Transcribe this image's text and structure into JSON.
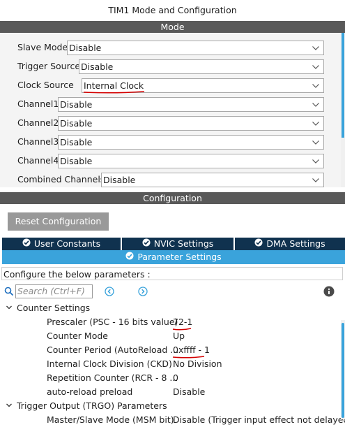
{
  "window": {
    "title": "TIM1 Mode and Configuration"
  },
  "mode": {
    "header": "Mode",
    "rows": [
      {
        "label": "Slave Mode",
        "value": "Disable"
      },
      {
        "label": "Trigger Source",
        "value": "Disable"
      },
      {
        "label": "Clock Source",
        "value": "Internal Clock"
      },
      {
        "label": "Channel1",
        "value": "Disable"
      },
      {
        "label": "Channel2",
        "value": "Disable"
      },
      {
        "label": "Channel3",
        "value": "Disable"
      },
      {
        "label": "Channel4",
        "value": "Disable"
      },
      {
        "label": "Combined Channels",
        "value": "Disable"
      }
    ]
  },
  "configuration": {
    "header": "Configuration",
    "reset_label": "Reset Configuration",
    "tabs": [
      "User Constants",
      "NVIC Settings",
      "DMA Settings"
    ],
    "active_tab": "Parameter Settings",
    "hint": "Configure the below parameters :",
    "search_placeholder": "Search (Ctrl+F)",
    "groups": [
      {
        "title": "Counter Settings",
        "params": [
          {
            "name": "Prescaler (PSC - 16 bits value)",
            "value": "72-1"
          },
          {
            "name": "Counter Mode",
            "value": "Up"
          },
          {
            "name": "Counter Period (AutoReload ...",
            "value": "0xffff - 1"
          },
          {
            "name": "Internal Clock Division (CKD)",
            "value": "No Division"
          },
          {
            "name": "Repetition Counter (RCR - 8 ...",
            "value": "0"
          },
          {
            "name": "auto-reload preload",
            "value": "Disable"
          }
        ]
      },
      {
        "title": "Trigger Output (TRGO) Parameters",
        "params": [
          {
            "name": "Master/Slave Mode (MSM bit)",
            "value": "Disable (Trigger input effect not delayed)"
          }
        ]
      }
    ]
  },
  "colors": {
    "section_bar": "#595959",
    "tab_dark": "#10324f",
    "tab_active": "#3aa3db",
    "annotation": "#d40000"
  },
  "icons": [
    "chevron-down-icon",
    "check-circle-icon",
    "search-icon",
    "nav-prev-icon",
    "nav-next-icon",
    "info-icon",
    "caret-down-icon"
  ]
}
